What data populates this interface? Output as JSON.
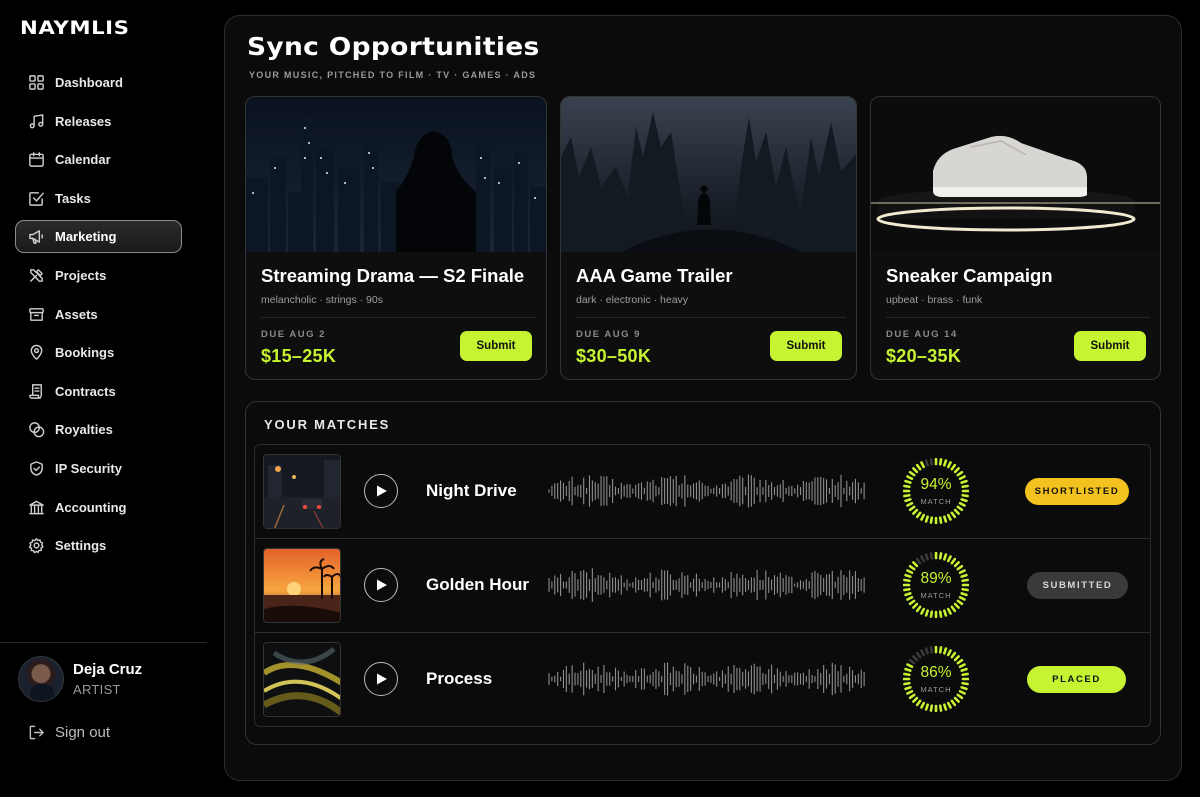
{
  "brand": {
    "logo": "NAYMLIS"
  },
  "sidebar": {
    "items": [
      {
        "label": "Dashboard",
        "icon": "grid-icon"
      },
      {
        "label": "Releases",
        "icon": "music-note-icon"
      },
      {
        "label": "Calendar",
        "icon": "calendar-icon"
      },
      {
        "label": "Tasks",
        "icon": "checkbox-icon"
      },
      {
        "label": "Marketing",
        "icon": "megaphone-icon",
        "active": true
      },
      {
        "label": "Projects",
        "icon": "tools-icon"
      },
      {
        "label": "Assets",
        "icon": "archive-icon"
      },
      {
        "label": "Bookings",
        "icon": "location-pin-icon"
      },
      {
        "label": "Contracts",
        "icon": "scroll-icon"
      },
      {
        "label": "Royalties",
        "icon": "coins-icon"
      },
      {
        "label": "IP Security",
        "icon": "shield-icon"
      },
      {
        "label": "Accounting",
        "icon": "bank-icon"
      },
      {
        "label": "Settings",
        "icon": "gear-icon"
      }
    ]
  },
  "user": {
    "name": "Deja Cruz",
    "role": "ARTIST"
  },
  "signout": {
    "label": "Sign out"
  },
  "page": {
    "title": "Sync Opportunities",
    "subtitle": "YOUR MUSIC, PITCHED TO FILM · TV · GAMES · ADS"
  },
  "opportunities": [
    {
      "title": "Streaming Drama — S2 Finale",
      "tags": "melancholic · strings · 90s",
      "due": "DUE AUG 2",
      "price": "$15–25K",
      "action": "Submit"
    },
    {
      "title": "AAA Game Trailer",
      "tags": "dark · electronic · heavy",
      "due": "DUE AUG 9",
      "price": "$30–50K",
      "action": "Submit"
    },
    {
      "title": "Sneaker Campaign",
      "tags": "upbeat · brass · funk",
      "due": "DUE AUG 14",
      "price": "$20–35K",
      "action": "Submit"
    }
  ],
  "matches": {
    "title": "YOUR MATCHES",
    "match_label": "MATCH",
    "rows": [
      {
        "track": "Night Drive",
        "match_pct": "94%",
        "match_value": 94,
        "status": "SHORTLISTED",
        "status_color": "#f4c21e"
      },
      {
        "track": "Golden Hour",
        "match_pct": "89%",
        "match_value": 89,
        "status": "SUBMITTED",
        "status_color": "#3a3a3a"
      },
      {
        "track": "Process",
        "match_pct": "86%",
        "match_value": 86,
        "status": "PLACED",
        "status_color": "#c6f432"
      }
    ]
  },
  "colors": {
    "accent": "#c6f432",
    "shortlisted": "#f4c21e",
    "background": "#000000"
  }
}
